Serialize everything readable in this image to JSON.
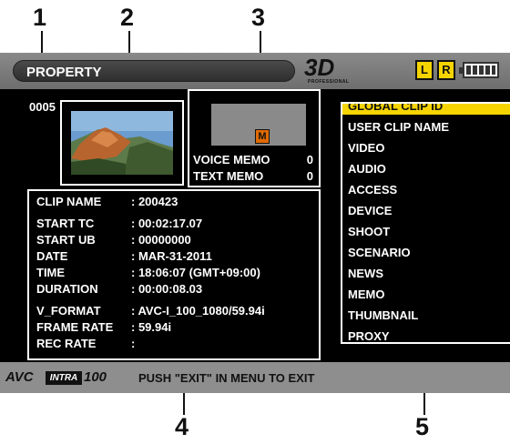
{
  "callouts": [
    "1",
    "2",
    "3",
    "4",
    "5"
  ],
  "header": {
    "title": "PROPERTY",
    "logo_3d": "3D",
    "logo_sub": "PROFESSIONAL",
    "channel_left": "L",
    "channel_right": "R",
    "battery_icon": "battery-icon"
  },
  "clip": {
    "number": "0005",
    "thumbnail_icon": "landscape-thumbnail"
  },
  "memo": {
    "marker": "M",
    "marker_color": "#e06a00",
    "voice_label": "VOICE MEMO",
    "voice_count": "0",
    "text_label": "TEXT MEMO",
    "text_count": "0"
  },
  "info": [
    {
      "label": "CLIP NAME",
      "value": ": 200423"
    },
    {
      "label": "START TC",
      "value": ": 00:02:17.07"
    },
    {
      "label": "START UB",
      "value": ": 00000000"
    },
    {
      "label": "DATE",
      "value": ": MAR-31-2011"
    },
    {
      "label": "TIME",
      "value": ": 18:06:07 (GMT+09:00)"
    },
    {
      "label": "DURATION",
      "value": ": 00:00:08.03"
    },
    {
      "label": "V_FORMAT",
      "value": ": AVC-I_100_1080/59.94i"
    },
    {
      "label": "FRAME RATE",
      "value": ": 59.94i"
    },
    {
      "label": "REC RATE",
      "value": ":"
    }
  ],
  "menu": {
    "selected_index": 0,
    "highlight_color": "#f6d400",
    "items": [
      "GLOBAL CLIP ID",
      "USER CLIP NAME",
      "VIDEO",
      "AUDIO",
      "ACCESS",
      "DEVICE",
      "SHOOT",
      "SCENARIO",
      "NEWS",
      "MEMO",
      "THUMBNAIL",
      "PROXY"
    ]
  },
  "footer": {
    "avc": "AVC",
    "intra": "INTRA",
    "codec_number": "100",
    "message": "PUSH \"EXIT\" IN MENU TO EXIT"
  }
}
